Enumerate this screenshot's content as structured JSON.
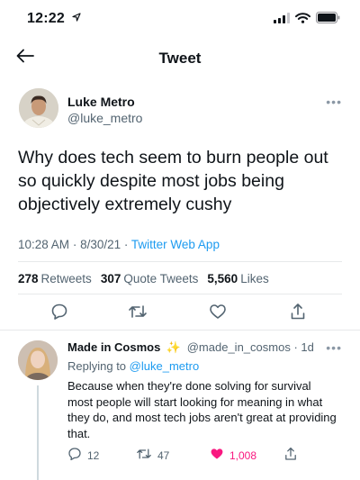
{
  "status_bar": {
    "time": "12:22",
    "location_icon": "location-arrow-icon",
    "icons": [
      "cellular-signal-icon",
      "wifi-icon",
      "battery-icon"
    ]
  },
  "nav": {
    "title": "Tweet",
    "back_icon": "back-arrow-icon"
  },
  "tweet": {
    "author_name": "Luke Metro",
    "author_handle": "@luke_metro",
    "text": "Why does tech seem to burn people out so quickly despite most jobs being objectively extremely cushy",
    "time": "10:28 AM",
    "date": "8/30/21",
    "separator": "·",
    "app": "Twitter Web App",
    "stats": {
      "retweets_count": "278",
      "retweets_label": "Retweets",
      "quote_tweets_count": "307",
      "quote_tweets_label": "Quote Tweets",
      "likes_count": "5,560",
      "likes_label": "Likes"
    },
    "actions": [
      "reply-icon",
      "retweet-icon",
      "like-icon",
      "share-icon"
    ]
  },
  "reply": {
    "author_name": "Made in Cosmos",
    "sparkle": "✨",
    "author_handle": "@made_in_cosmos",
    "separator": "·",
    "age": "1d",
    "replying_prefix": "Replying to",
    "replying_to": "@luke_metro",
    "text": "Because when they're done solving for survival most people will start looking for meaning in what they do, and most tech jobs aren't great at providing that.",
    "reply_count": "12",
    "retweet_count": "47",
    "like_count": "1,008",
    "liked": true
  },
  "colors": {
    "accent": "#1d9bf0",
    "like": "#f91880",
    "secondary_text": "#536471",
    "divider": "#e7e9ea"
  }
}
